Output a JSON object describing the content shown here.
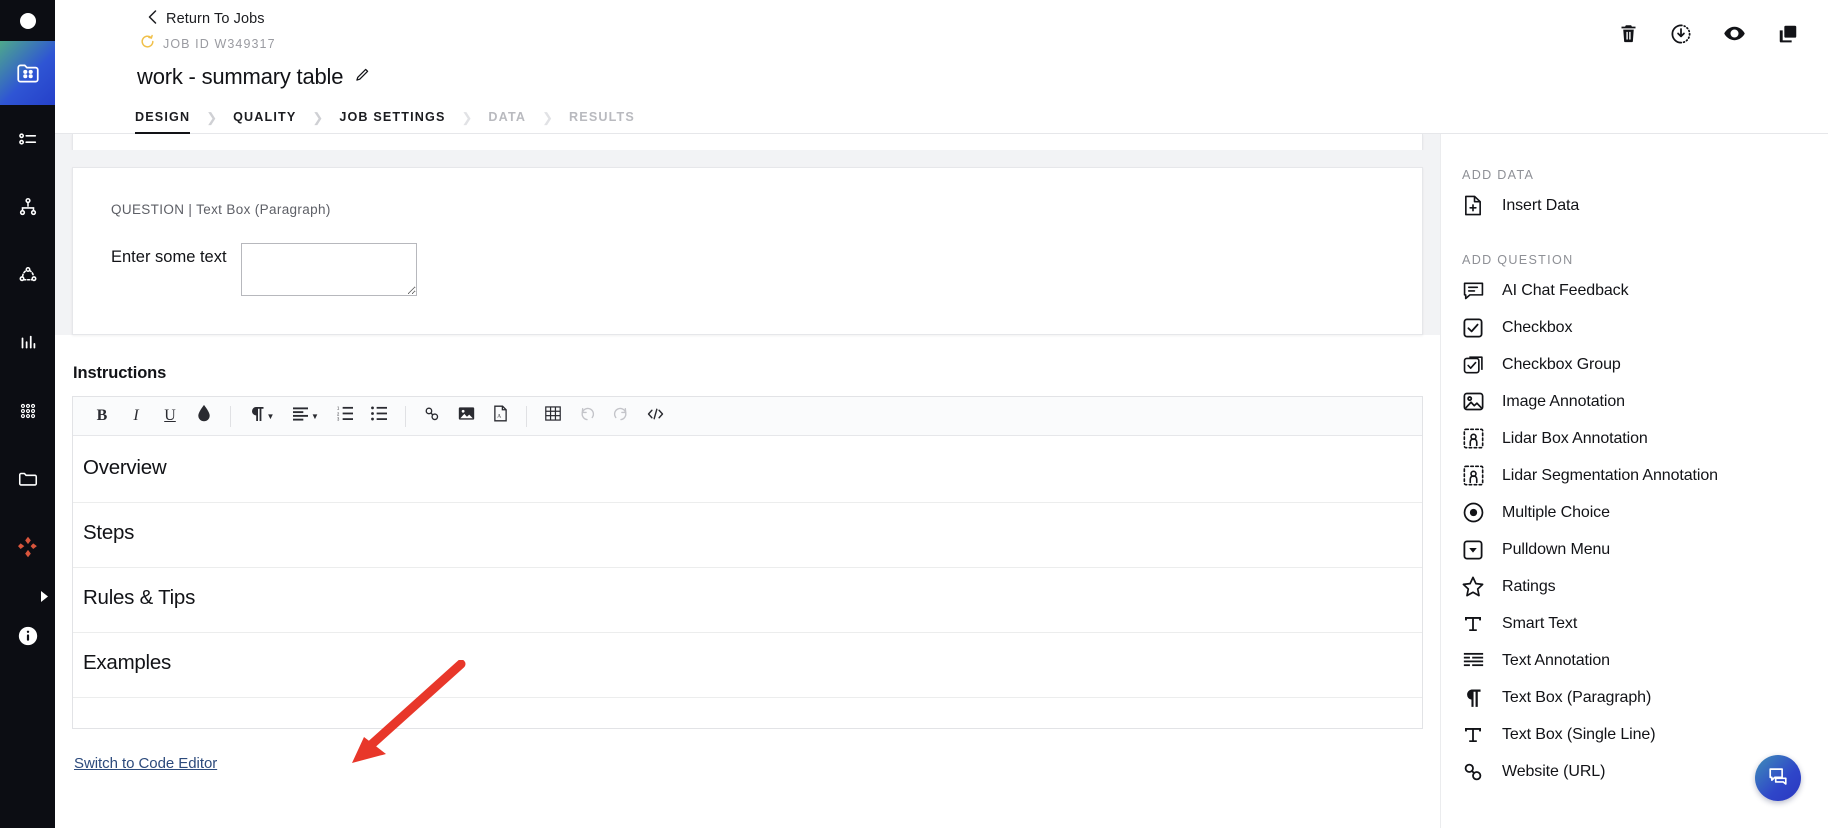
{
  "brand": {
    "accent": "#2f55d4",
    "annotation_color": "#e8372a",
    "link_color": "#2c4a7c"
  },
  "left_rail": {
    "logo": "circle-logo",
    "items": [
      {
        "icon": "folder-grid-icon",
        "name": "projects",
        "active": true
      },
      {
        "icon": "task-list-icon",
        "name": "tasks",
        "active": false
      },
      {
        "icon": "hierarchy-icon",
        "name": "workflows",
        "active": false
      },
      {
        "icon": "node-graph-icon",
        "name": "pipelines",
        "active": false
      },
      {
        "icon": "bar-chart-icon",
        "name": "analytics",
        "active": false
      },
      {
        "icon": "grid-dots-icon",
        "name": "datasets",
        "active": false
      },
      {
        "icon": "folder-icon",
        "name": "files",
        "active": false
      },
      {
        "icon": "diamond-cluster-icon",
        "name": "apps",
        "active": false
      }
    ],
    "expand_icon": "chevron-right-icon",
    "info_icon": "info-icon"
  },
  "header": {
    "back_icon": "chevron-left-icon",
    "back_label": "Return To Jobs",
    "refresh_icon": "refresh-icon",
    "job_id": "JOB ID W349317",
    "title": "work - summary table",
    "edit_icon": "pencil-icon",
    "actions": [
      {
        "icon": "trash-icon",
        "name": "delete-job"
      },
      {
        "icon": "download-clock-icon",
        "name": "export-job"
      },
      {
        "icon": "eye-icon",
        "name": "preview-job"
      },
      {
        "icon": "copy-icon",
        "name": "duplicate-job"
      }
    ]
  },
  "tabs": [
    {
      "label": "DESIGN",
      "active": true,
      "enabled": true
    },
    {
      "label": "QUALITY",
      "active": false,
      "enabled": true
    },
    {
      "label": "JOB SETTINGS",
      "active": false,
      "enabled": true
    },
    {
      "label": "DATA",
      "active": false,
      "enabled": false
    },
    {
      "label": "RESULTS",
      "active": false,
      "enabled": false
    }
  ],
  "question_card": {
    "label": "QUESTION | Text Box (Paragraph)",
    "prompt": "Enter some text",
    "input_value": "",
    "input_placeholder": ""
  },
  "instructions": {
    "heading": "Instructions",
    "toolbar": [
      {
        "name": "bold-button",
        "glyph": "B",
        "kind": "letter-bold",
        "dim": false
      },
      {
        "name": "italic-button",
        "glyph": "I",
        "kind": "letter-italic",
        "dim": false
      },
      {
        "name": "underline-button",
        "glyph": "U",
        "kind": "letter-underline",
        "dim": false
      },
      {
        "name": "text-color-button",
        "glyph": "droplet-icon",
        "kind": "icon",
        "dim": false
      },
      {
        "name": "divider",
        "glyph": "",
        "kind": "divider",
        "dim": false
      },
      {
        "name": "paragraph-style-dropdown",
        "glyph": "pilcrow-icon",
        "kind": "icon-caret",
        "dim": false
      },
      {
        "name": "align-dropdown",
        "glyph": "align-left-icon",
        "kind": "icon-caret",
        "dim": false
      },
      {
        "name": "numbered-list-button",
        "glyph": "ordered-list-icon",
        "kind": "icon",
        "dim": false
      },
      {
        "name": "bulleted-list-button",
        "glyph": "unordered-list-icon",
        "kind": "icon",
        "dim": false
      },
      {
        "name": "divider",
        "glyph": "",
        "kind": "divider",
        "dim": false
      },
      {
        "name": "insert-link-button",
        "glyph": "link-icon",
        "kind": "icon",
        "dim": false
      },
      {
        "name": "insert-image-button",
        "glyph": "image-icon",
        "kind": "icon",
        "dim": false
      },
      {
        "name": "insert-pdf-button",
        "glyph": "pdf-icon",
        "kind": "icon",
        "dim": false
      },
      {
        "name": "divider",
        "glyph": "",
        "kind": "divider",
        "dim": false
      },
      {
        "name": "insert-table-button",
        "glyph": "table-icon",
        "kind": "icon",
        "dim": false
      },
      {
        "name": "undo-button",
        "glyph": "undo-icon",
        "kind": "icon",
        "dim": true
      },
      {
        "name": "redo-button",
        "glyph": "redo-icon",
        "kind": "icon",
        "dim": true
      },
      {
        "name": "code-view-button",
        "glyph": "code-icon",
        "kind": "icon",
        "dim": false
      }
    ],
    "sections": [
      {
        "heading": "Overview"
      },
      {
        "heading": "Steps"
      },
      {
        "heading": "Rules & Tips"
      },
      {
        "heading": "Examples"
      }
    ],
    "switch_link": "Switch to Code Editor"
  },
  "right_panel": {
    "add_data_title": "ADD DATA",
    "add_data_items": [
      {
        "label": "Insert Data",
        "icon": "file-plus-icon"
      }
    ],
    "add_question_title": "ADD QUESTION",
    "add_question_items": [
      {
        "label": "AI Chat Feedback",
        "icon": "chat-bubble-icon"
      },
      {
        "label": "Checkbox",
        "icon": "checkbox-icon"
      },
      {
        "label": "Checkbox Group",
        "icon": "checkbox-group-icon"
      },
      {
        "label": "Image Annotation",
        "icon": "image-annotation-icon"
      },
      {
        "label": "Lidar Box Annotation",
        "icon": "lidar-box-icon"
      },
      {
        "label": "Lidar Segmentation Annotation",
        "icon": "lidar-segmentation-icon"
      },
      {
        "label": "Multiple Choice",
        "icon": "radio-button-icon"
      },
      {
        "label": "Pulldown Menu",
        "icon": "pulldown-icon"
      },
      {
        "label": "Ratings",
        "icon": "star-icon"
      },
      {
        "label": "Smart Text",
        "icon": "serif-t-icon"
      },
      {
        "label": "Text Annotation",
        "icon": "text-annotation-icon"
      },
      {
        "label": "Text Box (Paragraph)",
        "icon": "pilcrow-icon"
      },
      {
        "label": "Text Box (Single Line)",
        "icon": "serif-t-icon"
      },
      {
        "label": "Website (URL)",
        "icon": "link-icon"
      }
    ],
    "chat_fab_icon": "chat-icon"
  },
  "annotation": {
    "type": "red-arrow",
    "points_to": "Switch to Code Editor"
  }
}
